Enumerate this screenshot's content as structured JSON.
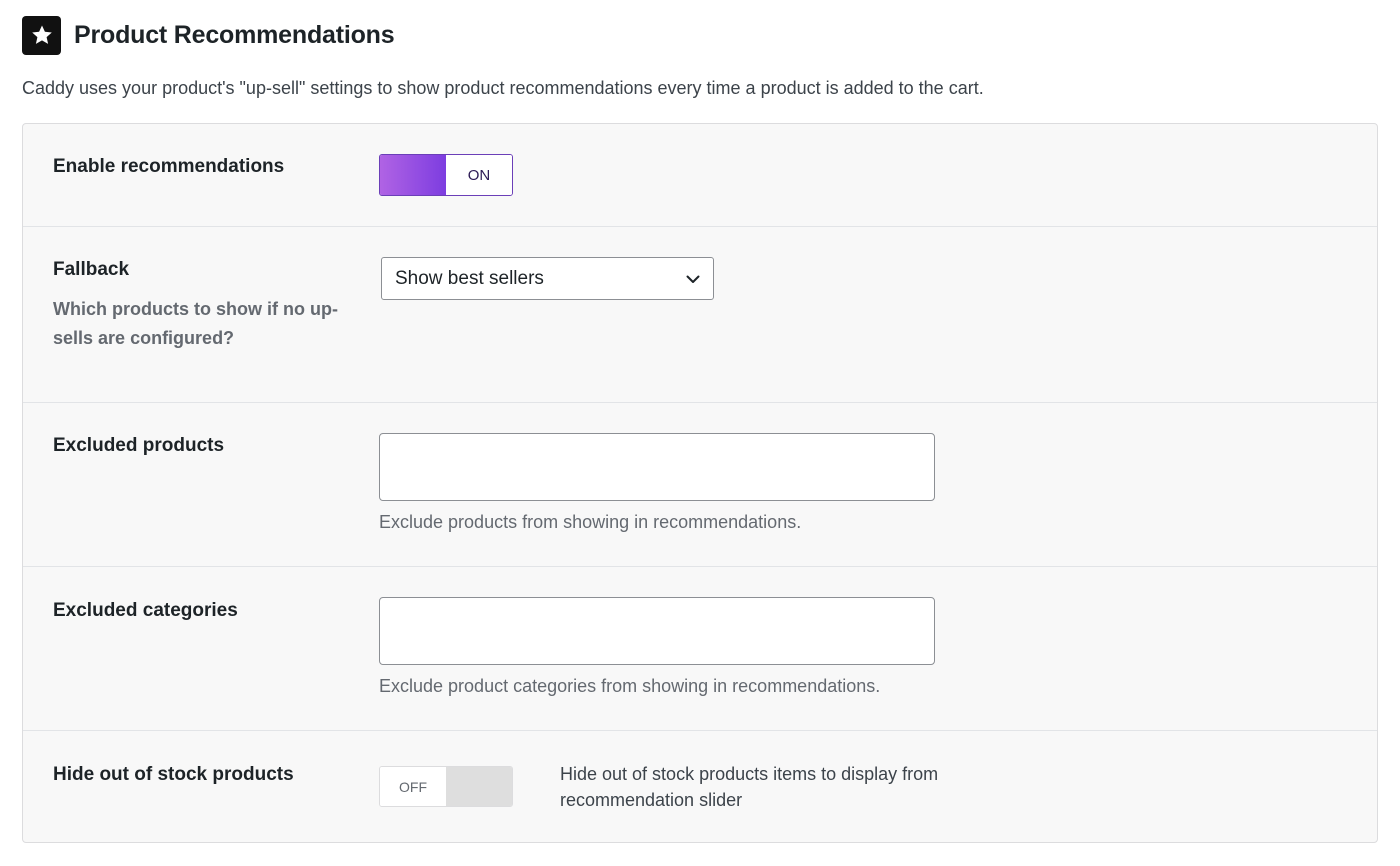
{
  "header": {
    "icon": "star-icon",
    "title": "Product Recommendations"
  },
  "intro": "Caddy uses your product's \"up-sell\" settings to show product recommendations every time a product is added to the cart.",
  "settings": {
    "enable": {
      "label": "Enable recommendations",
      "toggle_label": "ON",
      "toggle_state": true
    },
    "fallback": {
      "label": "Fallback",
      "help": "Which products to show if no up-sells are configured?",
      "selected": "Show best sellers",
      "icon": "chevron-down-icon"
    },
    "excluded_products": {
      "label": "Excluded products",
      "value": "",
      "description": "Exclude products from showing in recommendations."
    },
    "excluded_categories": {
      "label": "Excluded categories",
      "value": "",
      "description": "Exclude product categories from showing in recommendations."
    },
    "hide_out_of_stock": {
      "label": "Hide out of stock products",
      "toggle_label": "OFF",
      "toggle_state": false,
      "description": "Hide out of stock products items to display from recommendation slider"
    }
  },
  "colors": {
    "toggle_on_start": "#b063e4",
    "toggle_on_end": "#7d3de0",
    "toggle_off": "#dedede",
    "panel_bg": "#f8f8f8"
  }
}
